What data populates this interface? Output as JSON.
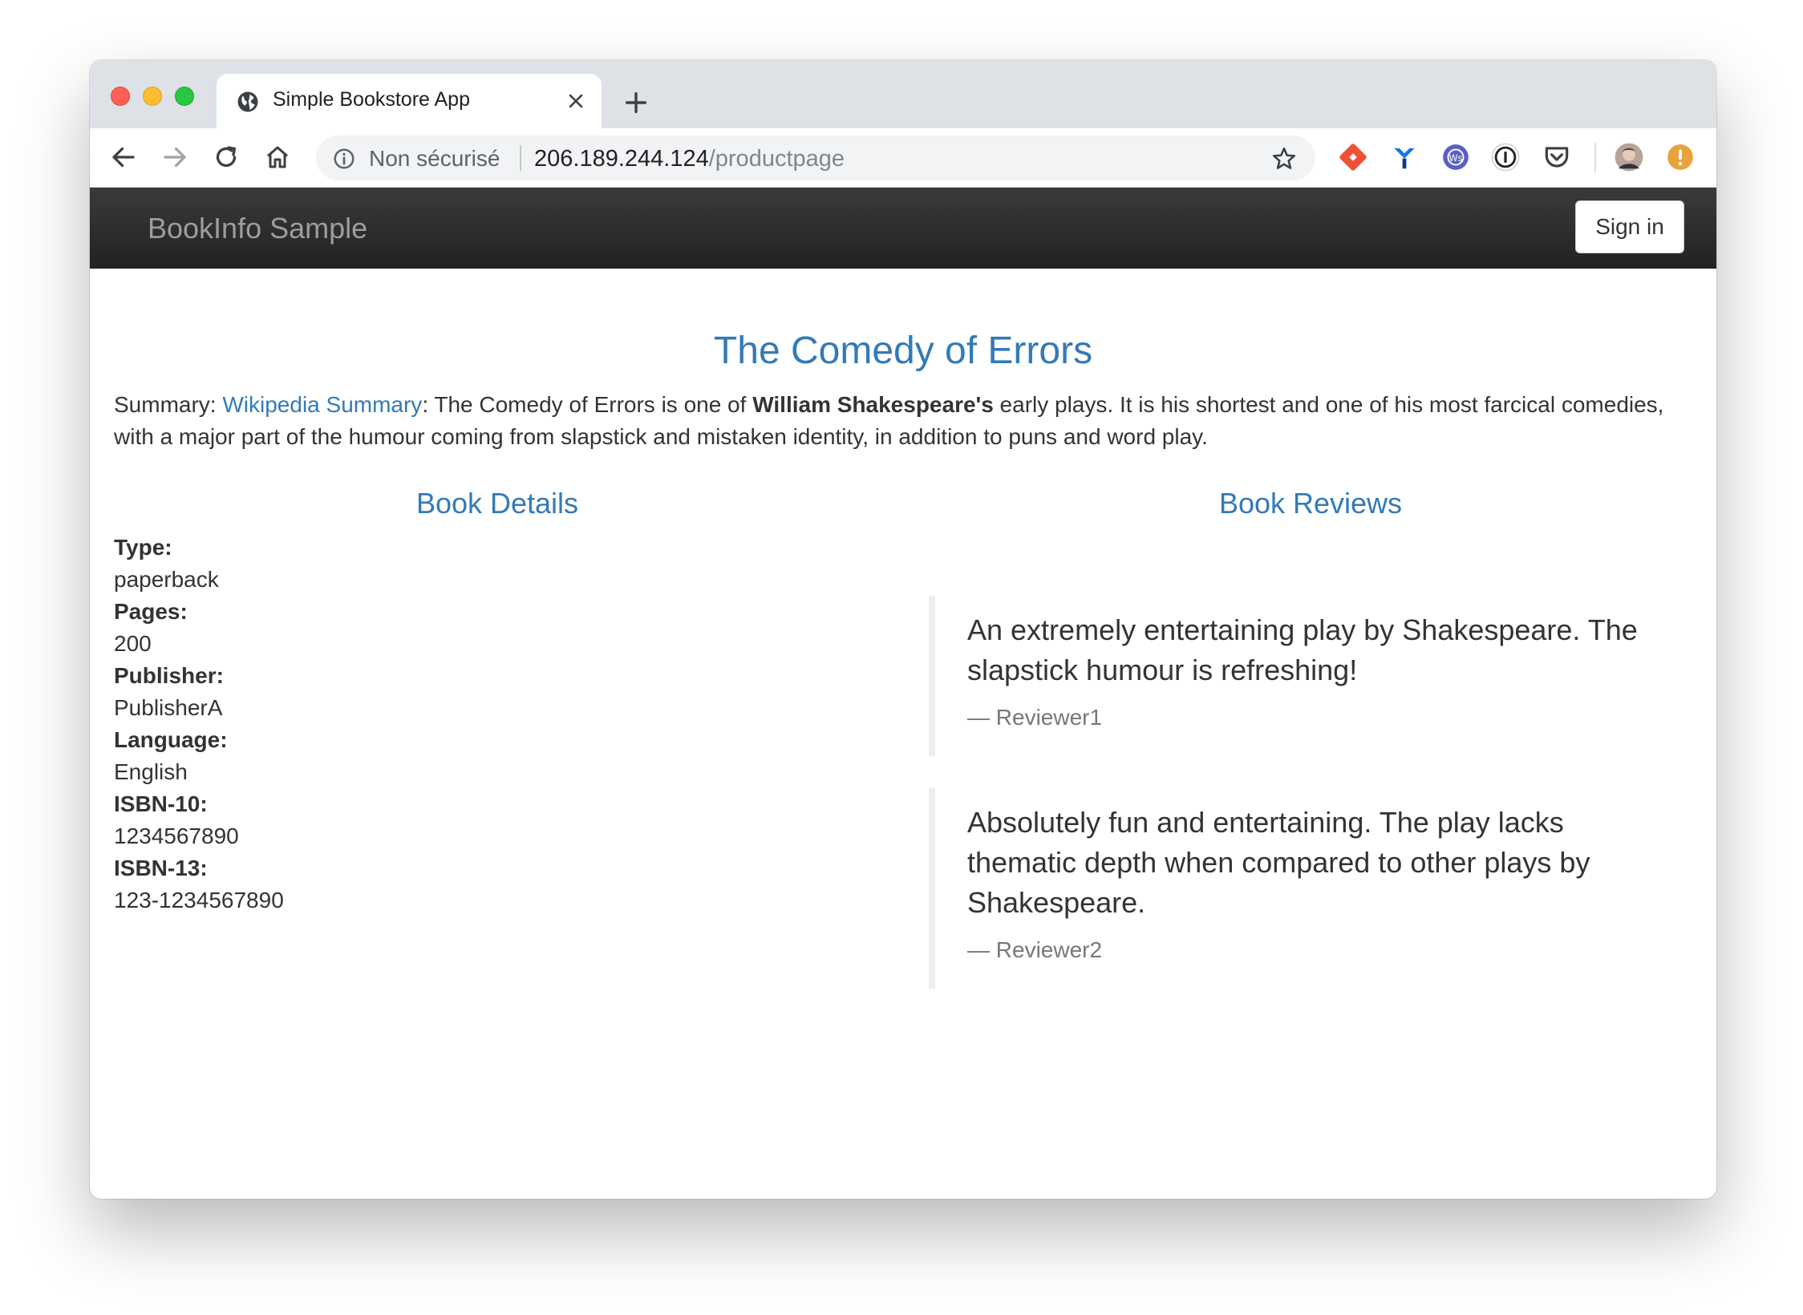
{
  "browser": {
    "tab_title": "Simple Bookstore App",
    "security_label": "Non sécurisé",
    "url_host": "206.189.244.124",
    "url_path": "/productpage"
  },
  "navbar": {
    "brand": "BookInfo Sample",
    "signin_label": "Sign in"
  },
  "book": {
    "title": "The Comedy of Errors",
    "summary_label": "Summary: ",
    "summary_link": "Wikipedia Summary",
    "summary_part1": ": The Comedy of Errors is one of ",
    "summary_bold": "William Shakespeare's",
    "summary_part2": " early plays. It is his shortest and one of his most farcical comedies, with a major part of the humour coming from slapstick and mistaken identity, in addition to puns and word play."
  },
  "details": {
    "heading": "Book Details",
    "fields": [
      {
        "label": "Type:",
        "value": "paperback"
      },
      {
        "label": "Pages:",
        "value": "200"
      },
      {
        "label": "Publisher:",
        "value": "PublisherA"
      },
      {
        "label": "Language:",
        "value": "English"
      },
      {
        "label": "ISBN-10:",
        "value": "1234567890"
      },
      {
        "label": "ISBN-13:",
        "value": "123-1234567890"
      }
    ]
  },
  "reviews": {
    "heading": "Book Reviews",
    "items": [
      {
        "text": "An extremely entertaining play by Shakespeare. The slapstick humour is refreshing!",
        "author": "— Reviewer1"
      },
      {
        "text": "Absolutely fun and entertaining. The play lacks thematic depth when compared to other plays by Shakespeare.",
        "author": "— Reviewer2"
      }
    ]
  },
  "colors": {
    "link_blue": "#337ab7",
    "navbar_dark": "#222222"
  },
  "icons": [
    "globe-icon",
    "close-icon",
    "plus-icon",
    "back-icon",
    "forward-icon",
    "reload-icon",
    "home-icon",
    "info-icon",
    "star-icon",
    "extension-icons",
    "avatar",
    "alert-icon"
  ]
}
